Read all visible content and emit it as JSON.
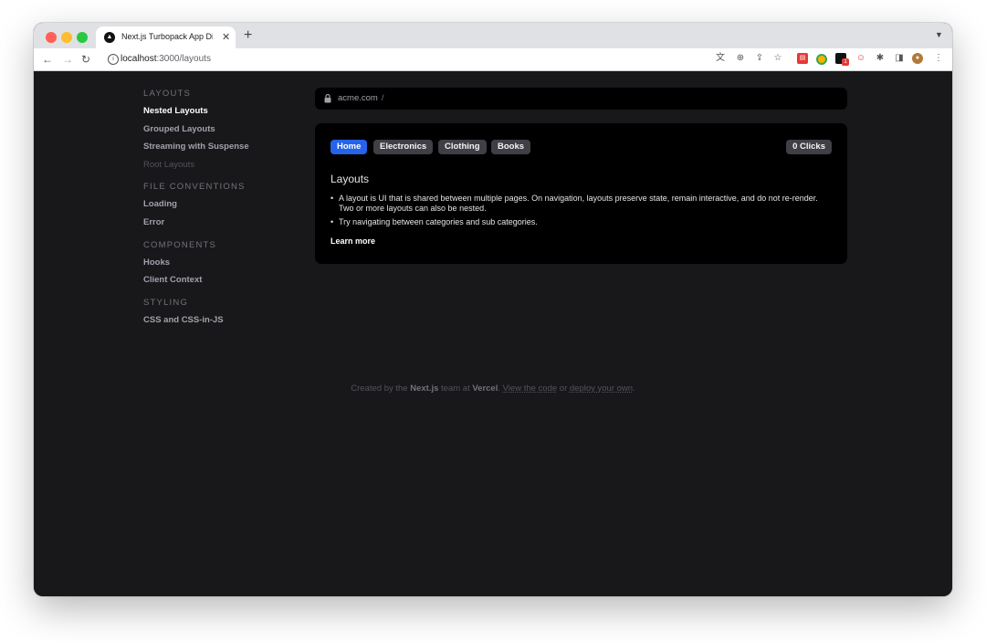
{
  "browser": {
    "tab_title": "Next.js Turbopack App Directory Playground",
    "tab_close": "✕",
    "new_tab": "+",
    "url_host": "localhost",
    "url_rest": ":3000/layouts",
    "favicon_glyph": "▲"
  },
  "sidebar": {
    "sections": [
      {
        "heading": "Layouts",
        "items": [
          "Nested Layouts",
          "Grouped Layouts",
          "Streaming with Suspense",
          "Root Layouts"
        ]
      },
      {
        "heading": "File Conventions",
        "items": [
          "Loading",
          "Error"
        ]
      },
      {
        "heading": "Components",
        "items": [
          "Hooks",
          "Client Context"
        ]
      },
      {
        "heading": "Styling",
        "items": [
          "CSS and CSS-in-JS"
        ]
      }
    ]
  },
  "addressbar": {
    "domain": "acme.com",
    "separator": "/"
  },
  "card": {
    "tabs": [
      "Home",
      "Electronics",
      "Clothing",
      "Books"
    ],
    "clicks_label": "0 Clicks",
    "title": "Layouts",
    "bullets": [
      "A layout is UI that is shared between multiple pages. On navigation, layouts preserve state, remain interactive, and do not re-render. Two or more layouts can also be nested.",
      "Try navigating between categories and sub categories."
    ],
    "learn_more": "Learn more"
  },
  "footer": {
    "created_by": "Created by the ",
    "nextjs": "Next.js",
    "team_at": " team at ",
    "vercel": "Vercel",
    "period": ". ",
    "view_code": "View the code",
    "or": " or ",
    "deploy": "deploy your own",
    "end": "."
  },
  "colors": {
    "page_bg": "#18181b",
    "card_bg": "#000000",
    "active_tab": "#2563eb",
    "pill_bg": "#3f3f46"
  }
}
